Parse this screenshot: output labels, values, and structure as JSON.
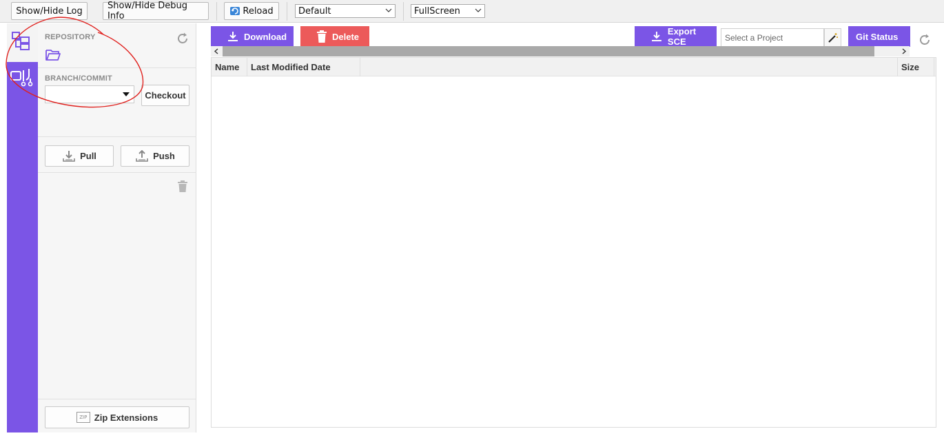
{
  "toolbar": {
    "show_hide_log": "Show/Hide Log",
    "show_hide_debug": "Show/Hide Debug Info",
    "reload": "Reload",
    "layout_select": "Default",
    "view_select": "FullScreen"
  },
  "side_panel": {
    "repository_label": "REPOSITORY",
    "branch_label": "BRANCH/COMMIT",
    "branch_value": "",
    "checkout": "Checkout",
    "pull": "Pull",
    "push": "Push",
    "zip_extensions": "Zip Extensions",
    "zip_icon_text": "ZIP"
  },
  "main": {
    "download": "Download",
    "delete": "Delete",
    "export_sce": "Export SCE",
    "project_placeholder": "Select a Project",
    "git_status": "Git Status",
    "columns": [
      "Name",
      "Last Modified Date",
      "Size"
    ]
  },
  "colors": {
    "accent": "#7b55e6",
    "delete": "#ec5a5a",
    "annotation": "#e0201d"
  },
  "icons": {
    "explorer": "tree-icon",
    "git": "git-branch-icon",
    "folder": "folder-open-icon",
    "refresh": "refresh-icon",
    "download": "download-icon",
    "trash": "trash-icon",
    "wand": "magic-wand-icon"
  }
}
